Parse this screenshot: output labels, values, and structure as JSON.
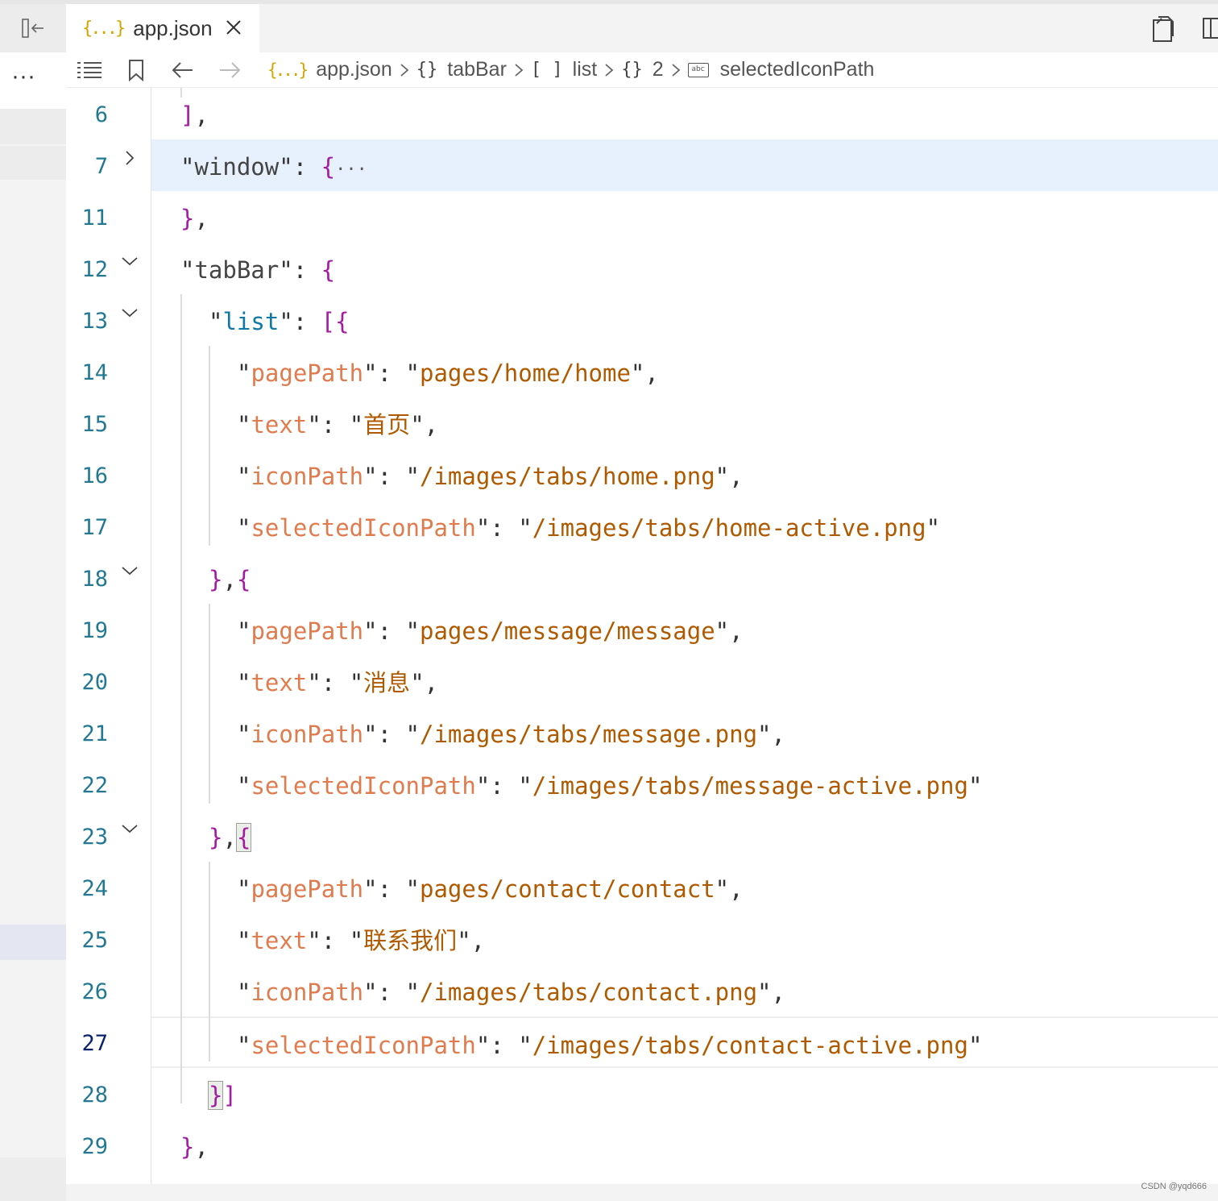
{
  "tab": {
    "label": "app.json",
    "icon": "{...}"
  },
  "breadcrumb": {
    "items": [
      {
        "symbol": "{...}",
        "label": "app.json"
      },
      {
        "symbol": "{}",
        "label": "tabBar"
      },
      {
        "symbol": "[ ]",
        "label": "list"
      },
      {
        "symbol": "{}",
        "label": "2"
      },
      {
        "symbol": "abc",
        "label": "selectedIconPath"
      }
    ]
  },
  "editor": {
    "lines": [
      {
        "n": "6",
        "text": "],"
      },
      {
        "n": "7",
        "text": "\"window\": {···"
      },
      {
        "n": "11",
        "text": "},"
      },
      {
        "n": "12",
        "text": "\"tabBar\": {"
      },
      {
        "n": "13",
        "text": "\"list\": [{"
      },
      {
        "n": "14",
        "key": "pagePath",
        "value": "pages/home/home"
      },
      {
        "n": "15",
        "key": "text",
        "value": "首页"
      },
      {
        "n": "16",
        "key": "iconPath",
        "value": "/images/tabs/home.png"
      },
      {
        "n": "17",
        "key": "selectedIconPath",
        "value": "/images/tabs/home-active.png"
      },
      {
        "n": "18",
        "text": "},{"
      },
      {
        "n": "19",
        "key": "pagePath",
        "value": "pages/message/message"
      },
      {
        "n": "20",
        "key": "text",
        "value": "消息"
      },
      {
        "n": "21",
        "key": "iconPath",
        "value": "/images/tabs/message.png"
      },
      {
        "n": "22",
        "key": "selectedIconPath",
        "value": "/images/tabs/message-active.png"
      },
      {
        "n": "23",
        "text": "},{"
      },
      {
        "n": "24",
        "key": "pagePath",
        "value": "pages/contact/contact"
      },
      {
        "n": "25",
        "key": "text",
        "value": "联系我们"
      },
      {
        "n": "26",
        "key": "iconPath",
        "value": "/images/tabs/contact.png"
      },
      {
        "n": "27",
        "key": "selectedIconPath",
        "value": "/images/tabs/contact-active.png"
      },
      {
        "n": "28",
        "text": "}]"
      },
      {
        "n": "29",
        "text": "},"
      }
    ]
  },
  "left": {
    "more_label": "···"
  },
  "watermark": "CSDN @yqd666",
  "colors": {
    "key": "#e07b4e",
    "string": "#b05a00",
    "punct": "#a31aa3",
    "line_number": "#237893",
    "highlight": "#e7f1fd"
  }
}
